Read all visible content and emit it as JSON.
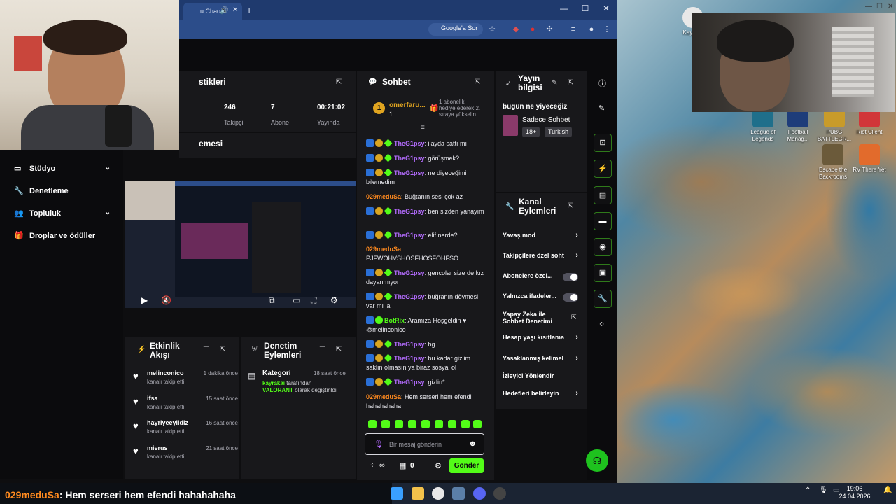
{
  "browser": {
    "tab_title": "u Chao",
    "google_button": "Google'a Sor"
  },
  "sidebar": {
    "cut_item": "",
    "items": [
      {
        "label": "Stüdyo",
        "icon": "monitor-icon",
        "has_chevron": true
      },
      {
        "label": "Denetleme",
        "icon": "wrench-icon",
        "has_chevron": false
      },
      {
        "label": "Topluluk",
        "icon": "users-icon",
        "has_chevron": true
      },
      {
        "label": "Droplar ve ödüller",
        "icon": "gift-icon",
        "has_chevron": false
      }
    ]
  },
  "stats": {
    "title_partial": "stikleri",
    "items": [
      {
        "value": "246",
        "label": "Takipçi"
      },
      {
        "value": "7",
        "label": "Abone"
      },
      {
        "value": "00:21:02",
        "label": "Yayında"
      }
    ]
  },
  "preview": {
    "title_partial": "emesi"
  },
  "activity_feed": {
    "title": "Etkinlik Akışı",
    "items": [
      {
        "user": "melinconico",
        "action": "kanalı takip etti",
        "time": "1 dakika önce"
      },
      {
        "user": "ifsa",
        "action": "kanalı takip etti",
        "time": "15 saat önce"
      },
      {
        "user": "hayriyeeyildiz",
        "action": "kanalı takip etti",
        "time": "16 saat önce"
      },
      {
        "user": "mierus",
        "action": "kanalı takip etti",
        "time": "21 saat önce"
      }
    ]
  },
  "moderation": {
    "title": "Denetim Eylemleri",
    "entry": {
      "type": "Kategori",
      "time": "18 saat önce",
      "actor": "kayrakai",
      "text_mid": "tarafından",
      "category": "VALORANT",
      "text_end": "olarak değiştirildi"
    }
  },
  "chat": {
    "title": "Sohbet",
    "pinned": {
      "user": "omerfaru...",
      "count": "1",
      "note": "1 abonelik hediye ederek 2. sıraya yükselin"
    },
    "messages": [
      {
        "user": "TheG1psy",
        "text": "ilayda sattı mı",
        "badges": true,
        "color": "purple"
      },
      {
        "user": "TheG1psy",
        "text": "görüşmek?",
        "badges": true,
        "color": "purple"
      },
      {
        "user": "TheG1psy",
        "text": "ne diyeceğimi bilemedim",
        "badges": true,
        "color": "purple"
      },
      {
        "user": "029meduSa",
        "text": "Buğtanın sesi çok az",
        "badges": false,
        "color": "orange"
      },
      {
        "user": "TheG1psy",
        "text": "ben sizden yanayım",
        "badges": true,
        "color": "purple"
      },
      {
        "user": "TheG1psy",
        "text": "elif nerde?",
        "badges": true,
        "color": "purple"
      },
      {
        "user": "029meduSa",
        "text": "PJFWOHVSHOSFHOSFOHFSO",
        "badges": false,
        "color": "orange"
      },
      {
        "user": "TheG1psy",
        "text": "gencolar size de kız dayanmıyor",
        "badges": true,
        "color": "purple"
      },
      {
        "user": "TheG1psy",
        "text": "buğranın dövmesi var mı la",
        "badges": true,
        "color": "purple"
      },
      {
        "user": "BotRix",
        "text": "Aramıza Hoşgeldin ♥ @melinconico",
        "badges": true,
        "color": "green"
      },
      {
        "user": "TheG1psy",
        "text": "hg",
        "badges": true,
        "color": "purple"
      },
      {
        "user": "TheG1psy",
        "text": "bu kadar gizlim saklın olmasın ya biraz sosyal ol",
        "badges": true,
        "color": "purple"
      },
      {
        "user": "TheG1psy",
        "text": "gizlin*",
        "badges": true,
        "color": "purple"
      },
      {
        "user": "029meduSa",
        "text": "Hem serseri hem efendi hahahahaha",
        "badges": false,
        "color": "orange"
      }
    ],
    "input_placeholder": "Bir mesaj gönderin",
    "points": "∞",
    "drops": "0",
    "send_label": "Gönder"
  },
  "stream_info": {
    "title": "Yayın bilgisi",
    "stream_title": "bugün ne yiyeceğiz",
    "category": "Sadece Sohbet",
    "tags": [
      "18+",
      "Turkish"
    ]
  },
  "channel_actions": {
    "title": "Kanal Eylemleri",
    "items": [
      {
        "label": "Yavaş mod",
        "control": "chevron"
      },
      {
        "label": "Takipçilere özel soht",
        "control": "chevron"
      },
      {
        "label": "Abonelere özel...",
        "control": "toggle"
      },
      {
        "label": "Yalnızca ifadeler...",
        "control": "toggle"
      },
      {
        "label": "Yapay Zeka ile Sohbet Denetimi",
        "control": "external"
      },
      {
        "label": "Hesap yaşı kısıtlama",
        "control": "chevron"
      },
      {
        "label": "Yasaklanmış kelimel",
        "control": "chevron"
      },
      {
        "label": "İzleyici Yönlendir",
        "control": "none"
      },
      {
        "label": "Hedefleri belirleyin",
        "control": "chevron"
      }
    ]
  },
  "desktop_icons": [
    {
      "label": "Kay Chr",
      "color": "#e8e8e8"
    },
    {
      "label": "League of Legends",
      "color": "#1f6f8b"
    },
    {
      "label": "Football Manag...",
      "color": "#1e3d7a"
    },
    {
      "label": "PUBG BATTLEGR...",
      "color": "#c89b2a"
    },
    {
      "label": "Riot Client",
      "color": "#d13639"
    },
    {
      "label": "Escape the Backrooms",
      "color": "#6b5a3a"
    },
    {
      "label": "RV There Yet",
      "color": "#e26b2c"
    }
  ],
  "overlay": {
    "name": "029meduSa",
    "message": ": Hem serseri hem efendi hahahahaha"
  },
  "taskbar": {
    "time": "19:06",
    "date": "24.04.2026"
  },
  "colors": {
    "accent": "#53fc18",
    "panel": "#18181b",
    "background": "#0e0e10"
  }
}
